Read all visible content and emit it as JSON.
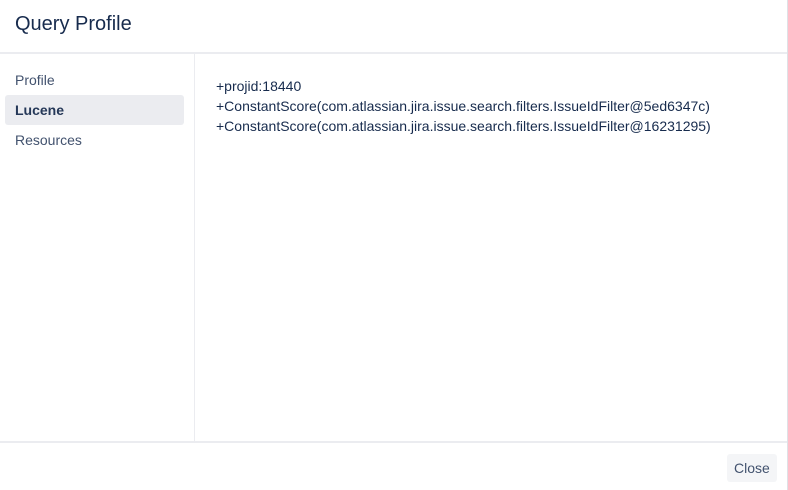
{
  "dialog": {
    "title": "Query Profile"
  },
  "sidebar": {
    "items": [
      {
        "label": "Profile",
        "active": false
      },
      {
        "label": "Lucene",
        "active": true
      },
      {
        "label": "Resources",
        "active": false
      }
    ]
  },
  "content": {
    "lines": [
      "+projid:18440",
      "+ConstantScore(com.atlassian.jira.issue.search.filters.IssueIdFilter@5ed6347c)",
      "+ConstantScore(com.atlassian.jira.issue.search.filters.IssueIdFilter@16231295)"
    ]
  },
  "footer": {
    "close_label": "Close"
  },
  "colors": {
    "title": "#172b4d",
    "active_nav_bg": "#ebecf0",
    "nav_text": "#42526e",
    "button_bg": "#f4f5f7"
  }
}
